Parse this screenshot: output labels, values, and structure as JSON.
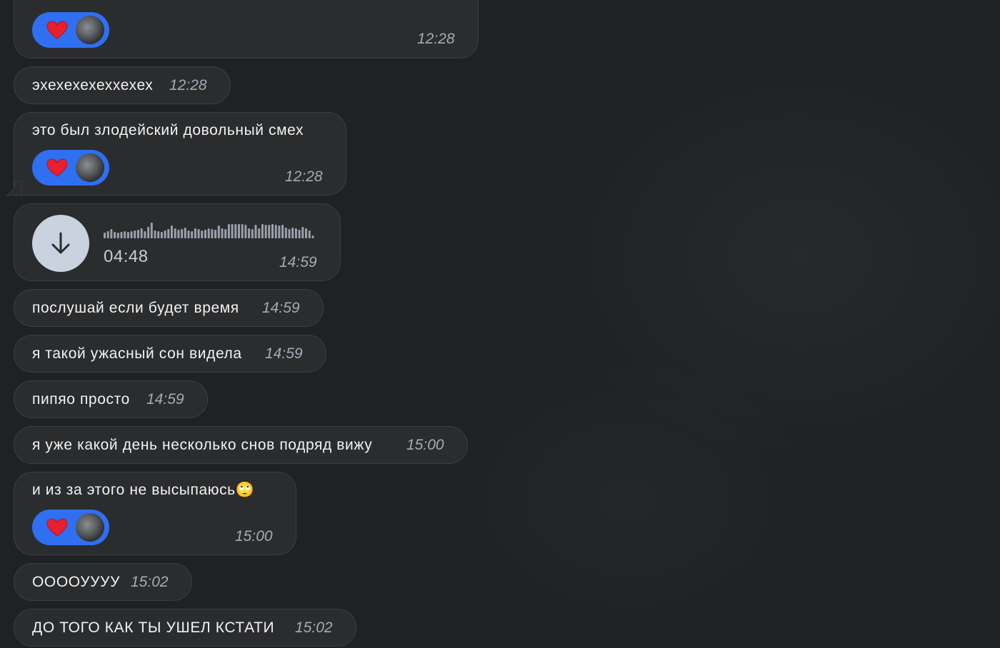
{
  "messages": [
    {
      "text": "",
      "time": "12:28",
      "reaction": {
        "emoji": "heart",
        "user": "avatar"
      }
    },
    {
      "text": "эхехехехеххехех",
      "time": "12:28"
    },
    {
      "text": "это был злодейский довольный смех",
      "time": "12:28",
      "reaction": {
        "emoji": "heart",
        "user": "avatar"
      }
    },
    {
      "voice": {
        "duration": "04:48"
      },
      "time": "14:59"
    },
    {
      "text": "послушай если будет время",
      "time": "14:59"
    },
    {
      "text": "я такой ужасный сон видела",
      "time": "14:59"
    },
    {
      "text": "пипяо просто",
      "time": "14:59"
    },
    {
      "text": "я уже какой день несколько снов подряд вижу",
      "time": "15:00"
    },
    {
      "text": "и из за этого не высыпаюсь",
      "emoji": "🙄",
      "time": "15:00",
      "reaction": {
        "emoji": "heart",
        "user": "avatar"
      }
    },
    {
      "text": "ООООУУУУ",
      "time": "15:02"
    },
    {
      "text": "ДО ТОГО КАК ТЫ УШЕЛ КСТАТИ",
      "time": "15:02"
    }
  ],
  "colors": {
    "background": "#1f2123",
    "bubble": "#2b2c2e",
    "reaction": "#2f6ff2",
    "time": "#a4abb6"
  }
}
